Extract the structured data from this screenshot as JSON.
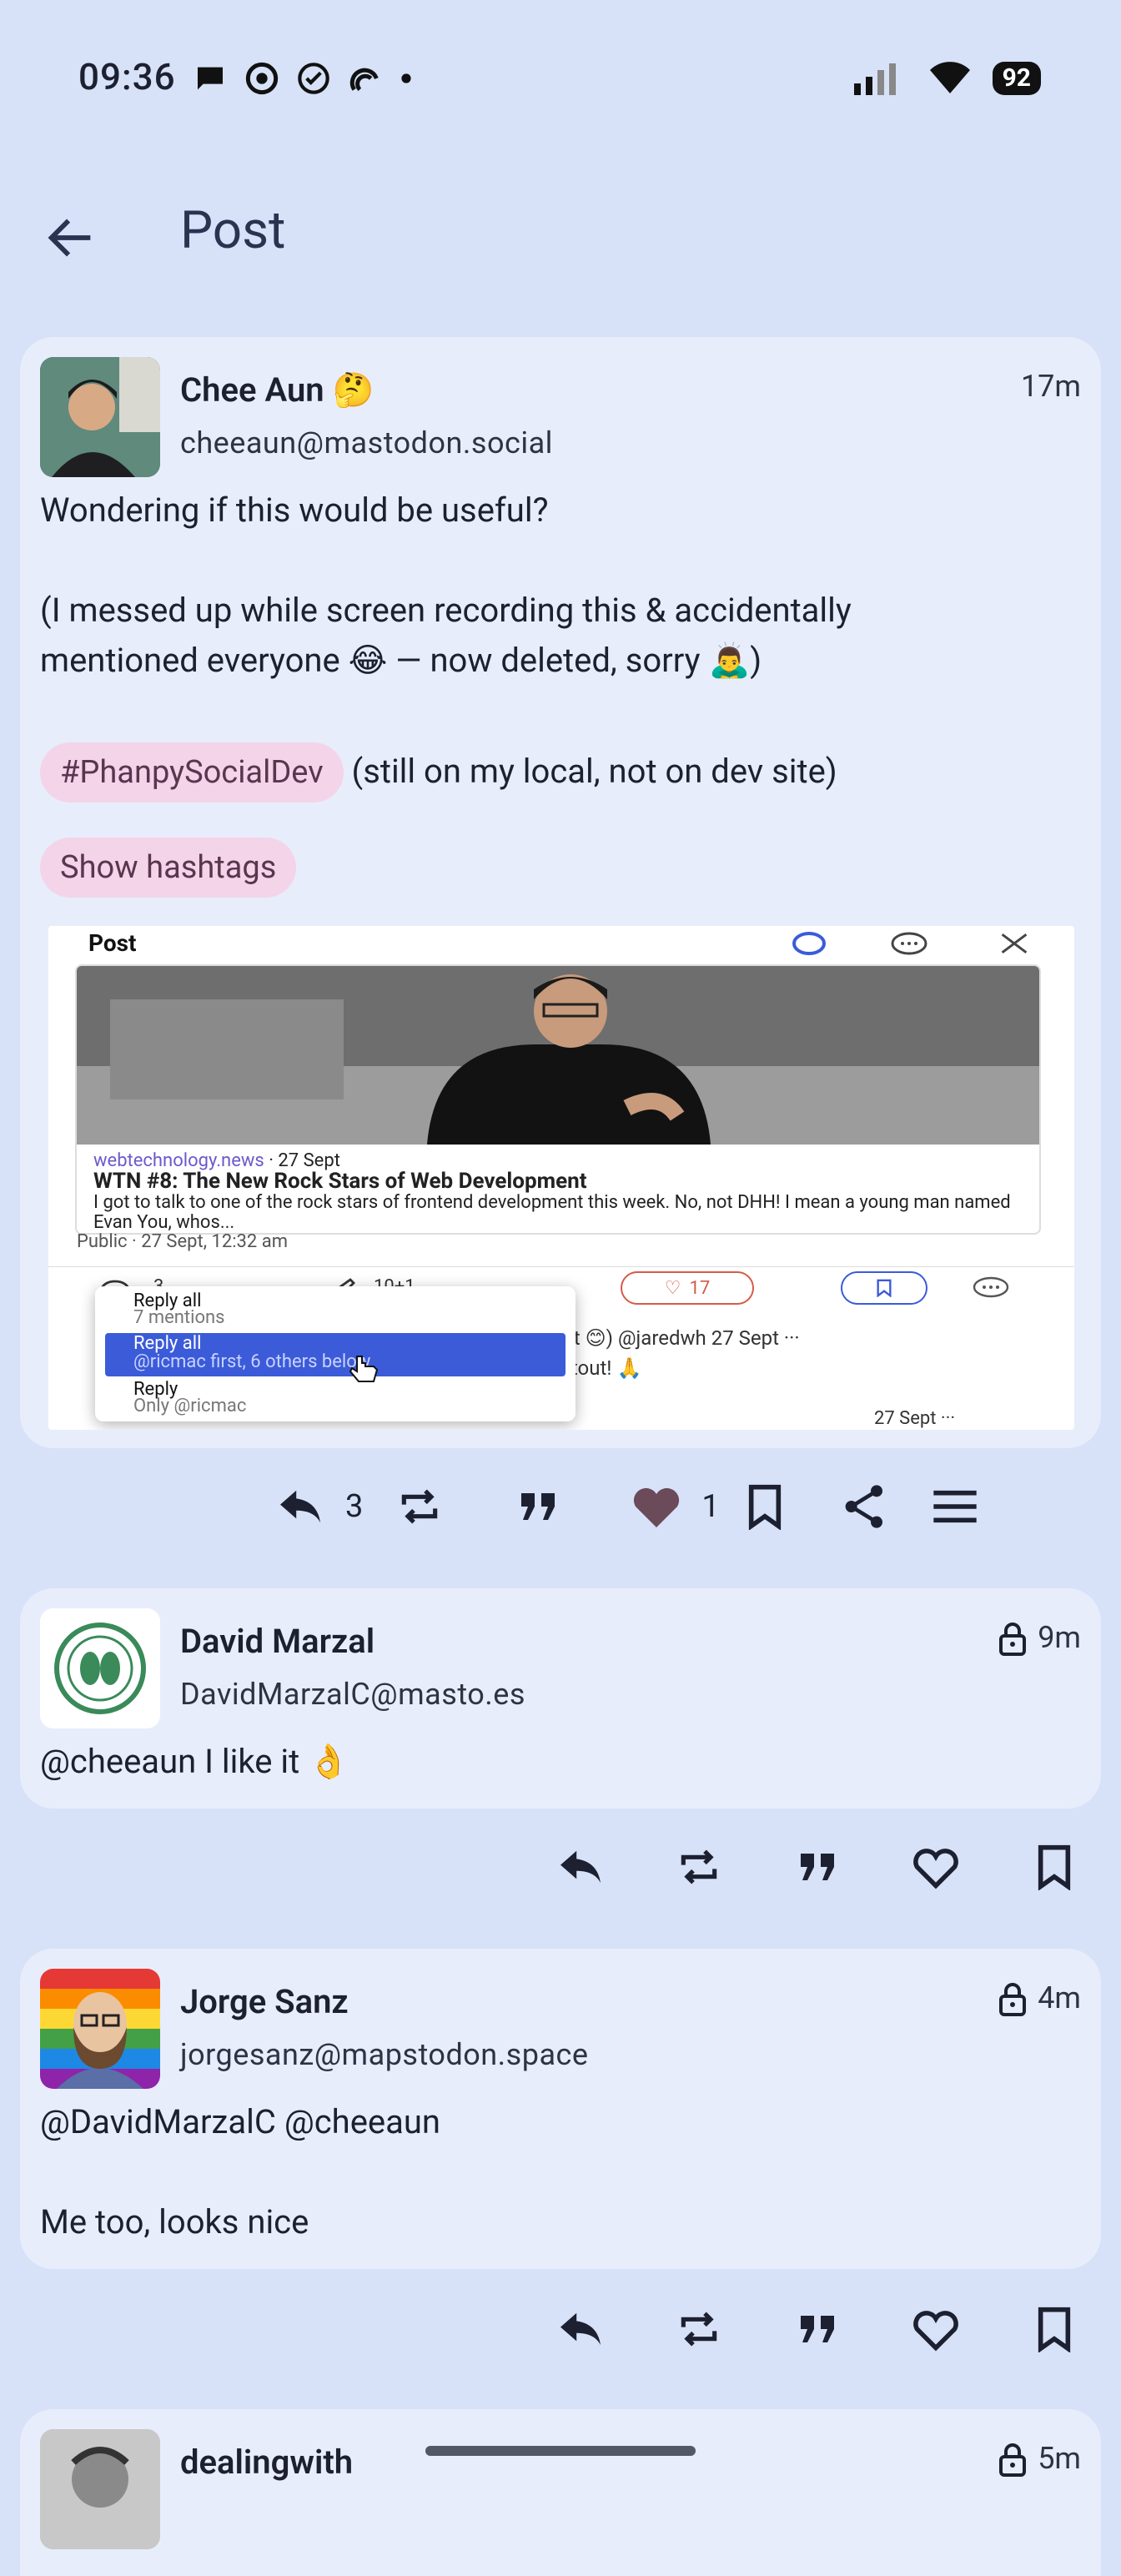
{
  "status": {
    "time": "09:36",
    "battery": "92"
  },
  "appbar": {
    "title": "Post"
  },
  "main_post": {
    "author": "Chee Aun 🤔",
    "handle": "cheeaun@mastodon.social",
    "time": "17m",
    "text1": "Wondering if this would be useful?",
    "text2": "(I messed up while screen recording this & accidentally\nmentioned everyone 😂 — now deleted, sorry 🙇‍♂️)",
    "hashtag": "#PhanpySocialDev",
    "hashtag_suffix": "(still on my local, not on dev site)",
    "show_hashtags": "Show hashtags",
    "replies": "3",
    "likes": "1",
    "media": {
      "header_title": "Post",
      "link_domain": "webtechnology.news",
      "link_date": " · 27 Sept",
      "link_title": "WTN #8: The New Rock Stars of Web Development",
      "link_desc": "I got to talk to one of the rock stars of frontend development this week. No, not DHH! I mean a young man named Evan You, whos...",
      "visibility": "Public · 27 Sept, 12:32 am",
      "stat_replies": "3",
      "stat_boosts": "10+1",
      "stat_likes": "17",
      "menu_reply_all": "Reply all",
      "menu_reply_all_sub": "7 mentions",
      "menu_reply_all2": "Reply all",
      "menu_reply_all2_sub": "@ricmac first, 6 others below",
      "menu_reply": "Reply",
      "menu_reply_sub": "Only @ricmac",
      "bg_reply_line1": "Net 😊) @jaredwh  27 Sept  ···",
      "bg_reply_line2": "outout! 🙏",
      "bg_reply_line3": "27 Sept  ···"
    }
  },
  "replies": [
    {
      "author": "David Marzal",
      "handle": "DavidMarzalC@masto.es",
      "time": "9m",
      "text": "@cheeaun I like it 👌"
    },
    {
      "author": "Jorge Sanz",
      "handle": "jorgesanz@mapstodon.space",
      "time": "4m",
      "text": "@DavidMarzalC @cheeaun\n\nMe too, looks nice"
    },
    {
      "author": "dealingwith",
      "time": "5m"
    }
  ],
  "colors": {
    "background": "#d7e2f8",
    "card": "#e8edfb",
    "pill": "#f4d4e8",
    "liked": "#6b4a5a",
    "menu_highlight": "#3b5bd9"
  }
}
